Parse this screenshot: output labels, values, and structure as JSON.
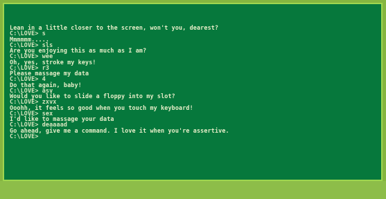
{
  "terminal": {
    "lines": [
      {
        "text": "Lean in a little closer to the screen, won't you, dearest?",
        "kind": "response"
      },
      {
        "text": "C:\\LOVE> s",
        "kind": "prompt"
      },
      {
        "text": "Mmmmmm.....",
        "kind": "response"
      },
      {
        "text": "C:\\LOVE> sls",
        "kind": "prompt"
      },
      {
        "text": "Are you enjoying this as much as I am?",
        "kind": "response"
      },
      {
        "text": "C:\\LOVE> wee",
        "kind": "prompt"
      },
      {
        "text": "Oh, yes, stroke my keys!",
        "kind": "response"
      },
      {
        "text": "C:\\LOVE> r3",
        "kind": "prompt"
      },
      {
        "text": "Please massage my data",
        "kind": "response"
      },
      {
        "text": "C:\\LOVE> 4",
        "kind": "prompt"
      },
      {
        "text": "Do that again, baby!",
        "kind": "response"
      },
      {
        "text": "C:\\LOVE> asv",
        "kind": "prompt"
      },
      {
        "text": "Would you like to slide a floppy into my slot?",
        "kind": "response"
      },
      {
        "text": "C:\\LOVE> zxvx",
        "kind": "prompt"
      },
      {
        "text": "Ooohh, it feels so good when you touch my keyboard!",
        "kind": "response"
      },
      {
        "text": "C:\\LOVE> sex",
        "kind": "prompt"
      },
      {
        "text": "I'd like to massage your data",
        "kind": "response"
      },
      {
        "text": "C:\\LOVE> deaaaad",
        "kind": "prompt"
      },
      {
        "text": "Go ahead, give me a command. I love it when you're assertive.",
        "kind": "response"
      },
      {
        "text": "C:\\LOVE>",
        "kind": "prompt"
      }
    ]
  },
  "colors": {
    "screen_background": "#06783c",
    "text": "#e6eec8",
    "frame": "#85b640"
  }
}
